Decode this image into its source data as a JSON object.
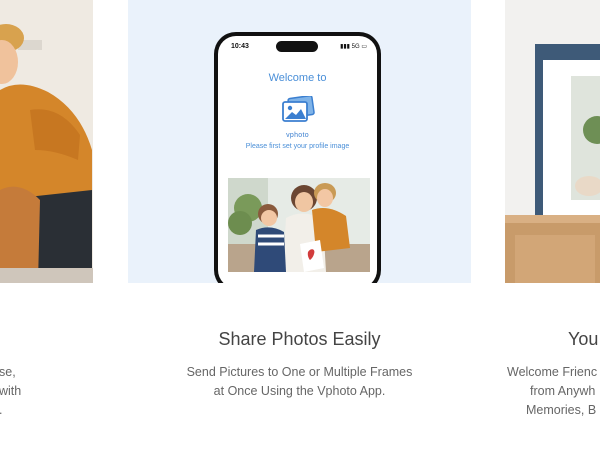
{
  "center_feature": {
    "title": "Share Photos Easily",
    "description_line1": "Send Pictures to One or Multiple Frames",
    "description_line2": "at Once Using the Vphoto App."
  },
  "phone_screen": {
    "status_time": "10:43",
    "status_right": "5G",
    "welcome": "Welcome to",
    "brand": "vphoto",
    "prompt": "Please first set your profile image"
  },
  "left_feature_cropped": {
    "line1": "se,",
    "line2": "with",
    "line3": "."
  },
  "right_feature_cropped": {
    "title": "You",
    "line1": "Welcome Frienc",
    "line2": "from Anywh",
    "line3": "Memories, B"
  },
  "colors": {
    "card_bg": "#eaf2fb",
    "accent_blue": "#4a8fd8",
    "frame_blue": "#3e5a78"
  },
  "icons": {
    "app_logo": "photo-icon",
    "signal": "signal-icon",
    "battery": "battery-icon"
  }
}
